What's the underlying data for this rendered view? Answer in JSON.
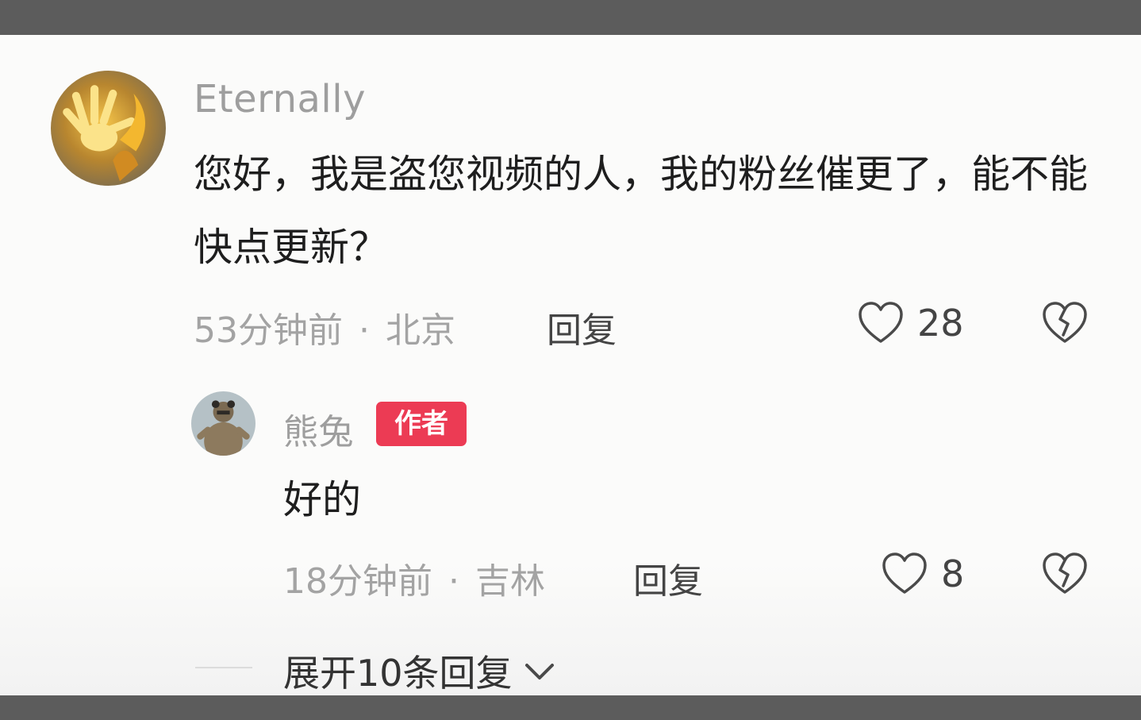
{
  "colors": {
    "username": "#9e9e9e",
    "body_text": "#1e1e1e",
    "meta_text": "#a3a3a3",
    "author_badge": "#ec3b54",
    "frame": "#5c5c5c"
  },
  "comment": {
    "avatar_icon": "flame-hand-avatar",
    "username": "Eternally",
    "text": "您好，我是盗您视频的人，我的粉丝催更了，能不能快点更新？",
    "time": "53分钟前",
    "dot": "·",
    "location": "北京",
    "reply_label": "回复",
    "like_icon": "heart-outline-icon",
    "like_count": "28",
    "dislike_icon": "broken-heart-icon"
  },
  "reply": {
    "avatar_icon": "bear-avatar",
    "username": "熊兔",
    "badge": "作者",
    "text": "好的",
    "time": "18分钟前",
    "dot": "·",
    "location": "吉林",
    "reply_label": "回复",
    "like_icon": "heart-outline-icon",
    "like_count": "8",
    "dislike_icon": "broken-heart-icon"
  },
  "expand": {
    "label": "展开10条回复",
    "icon": "chevron-down-icon"
  }
}
